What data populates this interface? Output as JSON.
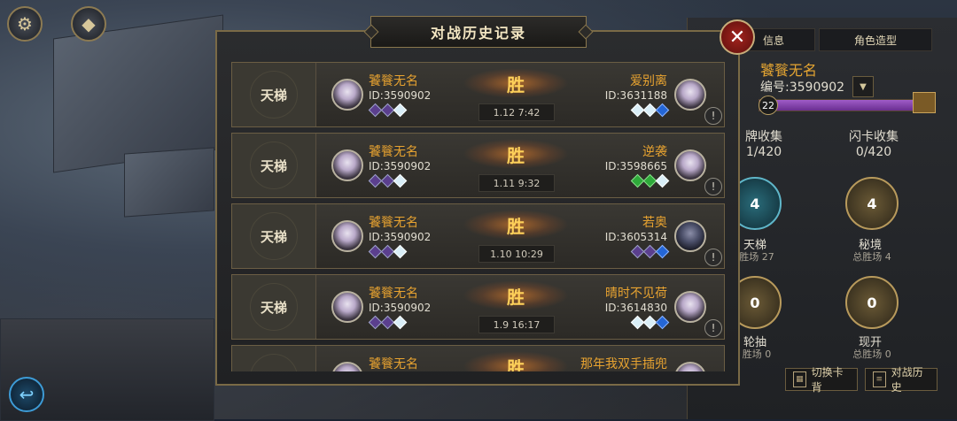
{
  "modal": {
    "title": "对战历史记录",
    "close_icon": "close-icon",
    "records": [
      {
        "mode": "天梯",
        "self_name": "饕餮无名",
        "self_id": "ID:3590902",
        "self_gems": [
          "purple",
          "purple",
          "white"
        ],
        "result": "胜",
        "time": "1.12  7:42",
        "opp_name": "爱别离",
        "opp_id": "ID:3631188",
        "opp_gems": [
          "white",
          "white",
          "blue"
        ],
        "opp_avatar": "light"
      },
      {
        "mode": "天梯",
        "self_name": "饕餮无名",
        "self_id": "ID:3590902",
        "self_gems": [
          "purple",
          "purple",
          "white"
        ],
        "result": "胜",
        "time": "1.11  9:32",
        "opp_name": "逆袭",
        "opp_id": "ID:3598665",
        "opp_gems": [
          "green",
          "green",
          "white"
        ],
        "opp_avatar": "light"
      },
      {
        "mode": "天梯",
        "self_name": "饕餮无名",
        "self_id": "ID:3590902",
        "self_gems": [
          "purple",
          "purple",
          "white"
        ],
        "result": "胜",
        "time": "1.10  10:29",
        "opp_name": "若奥",
        "opp_id": "ID:3605314",
        "opp_gems": [
          "purple",
          "purple",
          "blue"
        ],
        "opp_avatar": "dark"
      },
      {
        "mode": "天梯",
        "self_name": "饕餮无名",
        "self_id": "ID:3590902",
        "self_gems": [
          "purple",
          "purple",
          "white"
        ],
        "result": "胜",
        "time": "1.9  16:17",
        "opp_name": "晴时不见荷",
        "opp_id": "ID:3614830",
        "opp_gems": [
          "white",
          "white",
          "blue"
        ],
        "opp_avatar": "light"
      },
      {
        "mode": "天梯",
        "self_name": "饕餮无名",
        "self_id": "",
        "self_gems": [],
        "result": "胜",
        "time": "",
        "opp_name": "那年我双手插兜",
        "opp_id": "",
        "opp_gems": [],
        "opp_avatar": "light"
      }
    ]
  },
  "right_panel": {
    "tab_info": "信息",
    "tab_skin": "角色造型",
    "player_name": "饕餮无名",
    "player_id": "编号:3590902",
    "level": "22",
    "level_progress": 0.93,
    "card_collect_label": "牌收集",
    "card_collect_value": "1/420",
    "flash_collect_label": "闪卡收集",
    "flash_collect_value": "0/420",
    "modes": [
      {
        "badge": "4",
        "name": "天梯",
        "sub": "胜场 27"
      },
      {
        "badge": "4",
        "name": "秘境",
        "sub": "总胜场 4"
      },
      {
        "badge": "0",
        "name": "轮抽",
        "sub": "胜场 0"
      },
      {
        "badge": "0",
        "name": "现开",
        "sub": "总胜场 0"
      }
    ],
    "btn_switch": "切换卡背",
    "btn_history": "对战历史"
  },
  "colors": {
    "accent_gold": "#e8a330",
    "win": "#ffd15a",
    "close_red": "#a3241e"
  }
}
